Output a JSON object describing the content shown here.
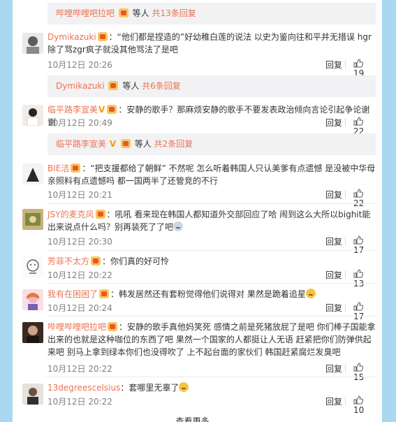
{
  "threads": [
    {
      "subbar": {
        "name": "哔哩哔哩吧拉吧",
        "suffix": "等人",
        "count_text": "共13条回复"
      }
    },
    {
      "user": "Dymikazuki",
      "text": "：“他们都是捏造的”好幼稚白莲的说法 以史为鉴向往和平并无措误 hgr除了骂zgr疯子就没其他骂法了是吧",
      "time": "10月12日 20:26",
      "reply": "回复",
      "likes": "19",
      "subbar": {
        "name": "Dymikazuki",
        "suffix": "等人",
        "count_text": "共6条回复"
      }
    },
    {
      "user": "临平路李宣美",
      "text": "：安静的歌手？那麻烦安静的歌手不要发表政治倾向言论引起争论谢谢",
      "time": "10月12日 20:49",
      "reply": "回复",
      "likes": "22",
      "subbar": {
        "name": "临平路李宣美",
        "suffix": "等人",
        "count_text": "共2条回复"
      }
    },
    {
      "user": "BIE洁",
      "text": "：“把支援都给了朝鲜” 不然呢 怎么听着韩国人只认美爹有点遗憾 是没被中华母亲照料有点遗憾吗 都一国两半了还管竞的不行",
      "time": "10月12日 20:21",
      "reply": "回复",
      "likes": "22"
    },
    {
      "user": "JSY的麦克风",
      "text": "：吼吼 看来现在韩国人都知道外交部回应了哈 闹到这么大所以bighit能出来说点什么吗？别再装死了了吧",
      "time": "10月12日 20:30",
      "reply": "回复",
      "likes": "17"
    },
    {
      "user": "芳菲不太方",
      "text": "：你们真的好可怜",
      "time": "10月12日 20:22",
      "reply": "回复",
      "likes": "13"
    },
    {
      "user": "我有在困困了",
      "text": "：韩发居然还有套粉觉得他们说得对 果然是跪着追星",
      "time": "10月12日 20:24",
      "reply": "回复",
      "likes": "17"
    },
    {
      "user": "哔哩哔哩吧拉吧",
      "text": "：安静的歌手真他妈笑死 感情之前是死猪放屁了是吧 你们棒子国能拿出来的也就是这种咖位的东西了吧 果然一个国家的人都挺让人无语 赶紧把你们防弹供起来吧 别马上拿到绿本你们也没得吹了 上不起台面的家伙们 韩国赶紧腐烂发臭吧",
      "time": "10月12日 20:22",
      "reply": "回复",
      "likes": "15"
    },
    {
      "user": "13degreescelsius",
      "text": "：套哪里无辜了",
      "time": "10月12日 20:22",
      "reply": "回复",
      "likes": "10"
    }
  ],
  "more_label": "查看更多",
  "colors": {
    "link": "#eb7350",
    "page_bg": "#a9d8f0",
    "subbar_bg": "#f2f2f5"
  }
}
